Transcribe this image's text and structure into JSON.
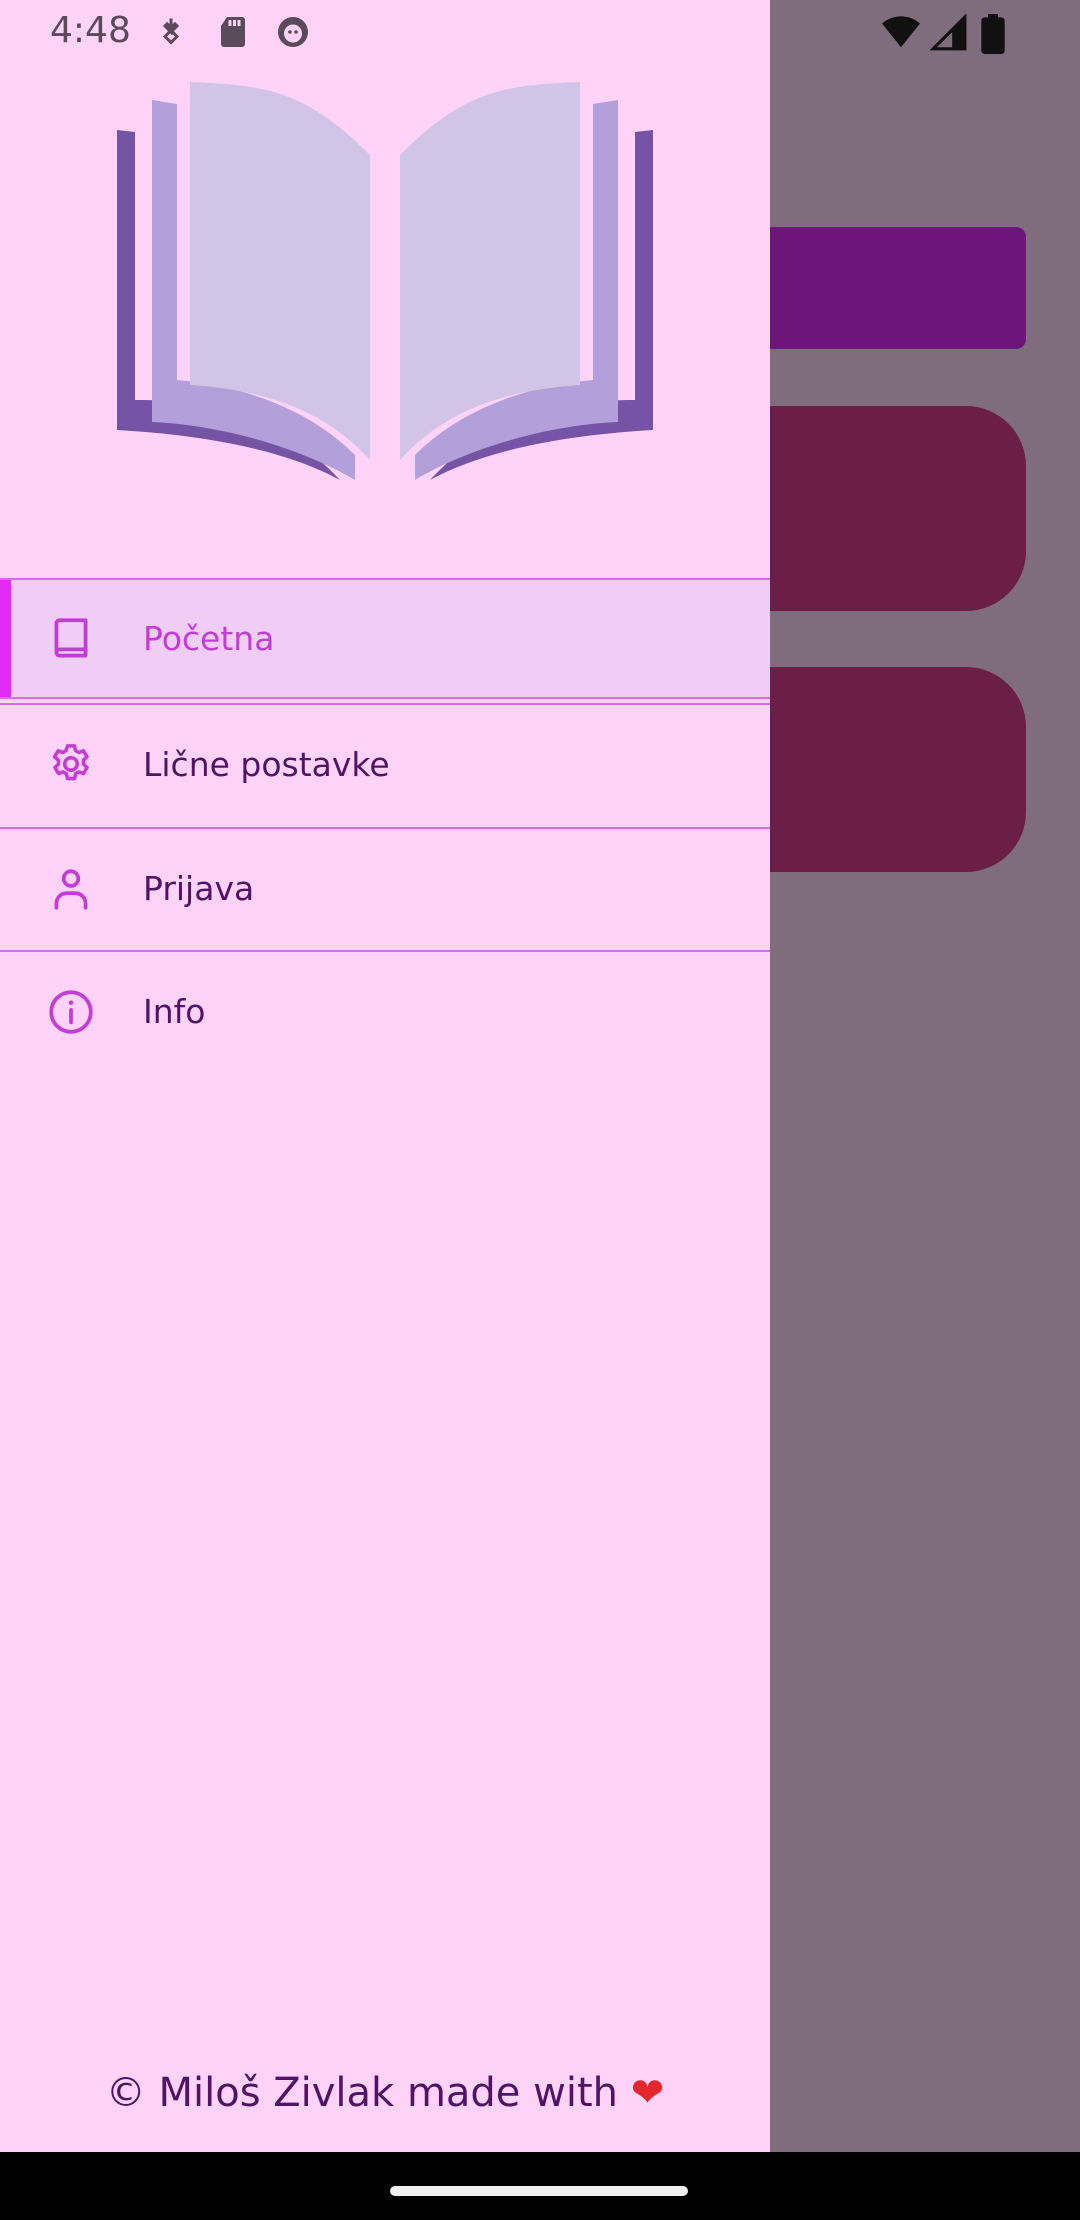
{
  "status_bar": {
    "time": "4:48",
    "left_icons": [
      "download-icon",
      "sd-card-icon",
      "android-debug-icon"
    ],
    "right_icons": [
      "wifi-icon",
      "cell-signal-icon",
      "battery-icon"
    ]
  },
  "drawer": {
    "logo_icon": "open-book-logo",
    "items": [
      {
        "label": "Početna",
        "icon": "book-icon",
        "selected": true
      },
      {
        "label": "Lične postavke",
        "icon": "gear-icon",
        "selected": false
      },
      {
        "label": "Prijava",
        "icon": "person-icon",
        "selected": false
      },
      {
        "label": "Info",
        "icon": "info-icon",
        "selected": false
      }
    ],
    "footer_text": "© Miloš Zivlak made with",
    "footer_heart": "❤"
  },
  "colors": {
    "drawer_bg": "#ffd2f8",
    "selected_bg": "#f0cdf4",
    "accent": "#e12bf2",
    "text": "#4f1466",
    "divider": "#d66ce0",
    "scrim": "#7f6c7c"
  }
}
